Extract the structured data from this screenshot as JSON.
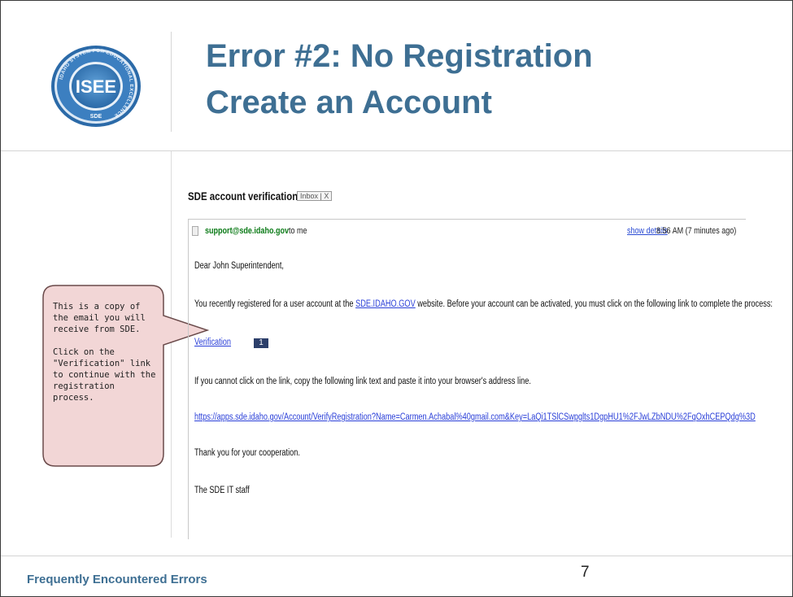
{
  "header": {
    "title_line1": "Error #2:  No Registration",
    "title_line2": "Create an Account",
    "logo_text": "ISEE",
    "logo_ring_text": "IDAHO SYSTEM FOR EDUCATIONAL EXCELLENCE",
    "logo_bottom_text": "SDE"
  },
  "callout": {
    "paragraph1": "This is a copy of the email you will receive from SDE.",
    "paragraph2": "Click on the \"Verification\" link to continue with the registration process."
  },
  "email": {
    "subject": "SDE account verification",
    "inbox_label": "Inbox | X",
    "sender": "support@sde.idaho.gov",
    "recipient": "to me",
    "show_details": "show details",
    "time": "8:56 AM (7 minutes ago)",
    "greeting": "Dear John Superintendent,",
    "body_before_link": "You recently registered for a user account at the ",
    "site_link": "SDE.IDAHO.GOV",
    "body_after_link": " website. Before your account can be activated, you must click on the following link to complete the process:",
    "verification_link": "Verification",
    "verification_badge": "1",
    "copy_instruction": "If you cannot click on the link, copy the following link text and paste it into your browser's address line.",
    "url": "https://apps.sde.idaho.gov/Account/VerifyRegistration?Name=Carmen.Achabal%40gmail.com&Key=LaQi1TSlCSwpglts1DgpHU1%2FJwLZbNDU%2FqOxhCEPQdg%3D",
    "thanks": "Thank you for your cooperation.",
    "signature": "The SDE IT staff"
  },
  "footer": {
    "label": "Frequently Encountered Errors",
    "page_number": "7"
  },
  "colors": {
    "title": "#3e6f93",
    "callout_fill": "#f2d6d6",
    "callout_stroke": "#6a4a4a",
    "link": "#2a3fd8",
    "sender": "#0a7a16"
  }
}
